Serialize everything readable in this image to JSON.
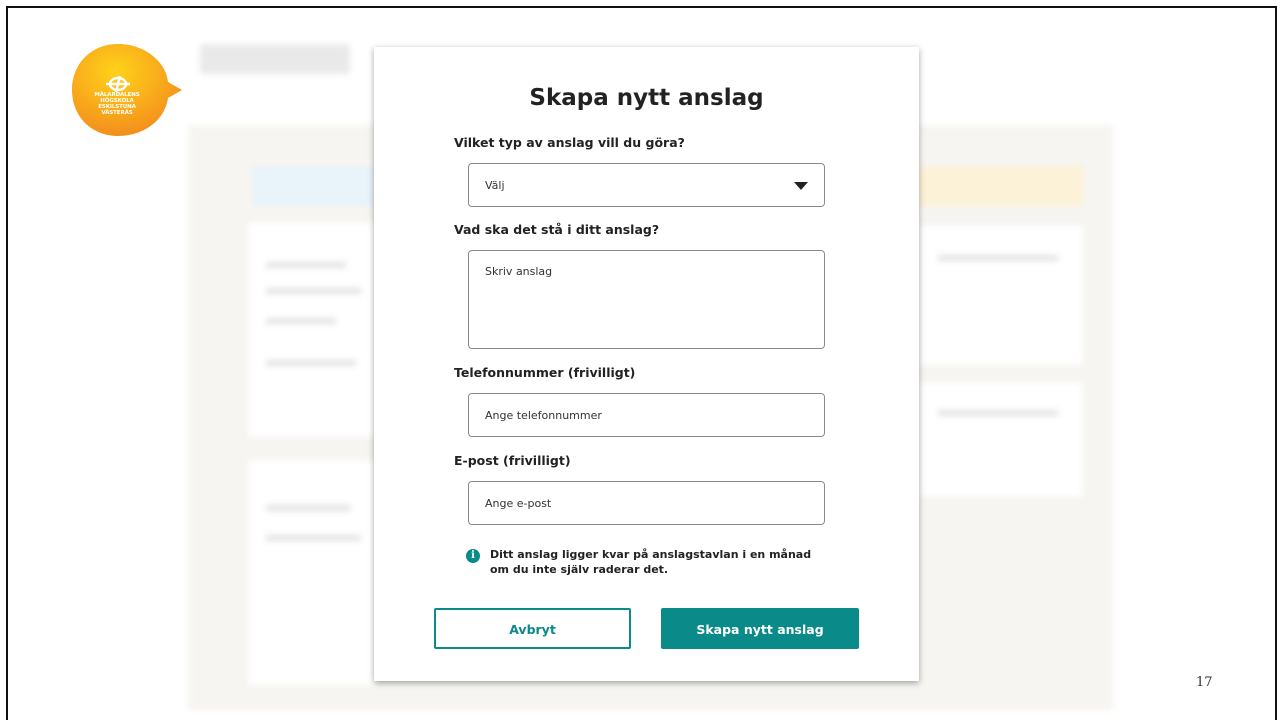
{
  "logo": {
    "line1": "MÄLARDALENS HÖGSKOLA",
    "line2": "ESKILSTUNA VÄSTERÅS",
    "brand_color": "#f39a1e"
  },
  "modal": {
    "title": "Skapa nytt anslag",
    "type_label": "Vilket typ av anslag vill du göra?",
    "type_select": {
      "value": "Välj",
      "icon": "caret-down-icon"
    },
    "text_label": "Vad ska det stå i ditt anslag?",
    "text_placeholder": "Skriv anslag",
    "phone_label": "Telefonnummer (frivilligt)",
    "phone_placeholder": "Ange telefonnummer",
    "email_label": "E-post (frivilligt)",
    "email_placeholder": "Ange e-post",
    "info_icon": "info-icon",
    "info_text": "Ditt anslag ligger kvar på anslagstavlan i en månad om du inte själv raderar det.",
    "cancel_label": "Avbryt",
    "create_label": "Skapa nytt anslag",
    "accent_color": "#0a8a88"
  },
  "page_number": "17"
}
